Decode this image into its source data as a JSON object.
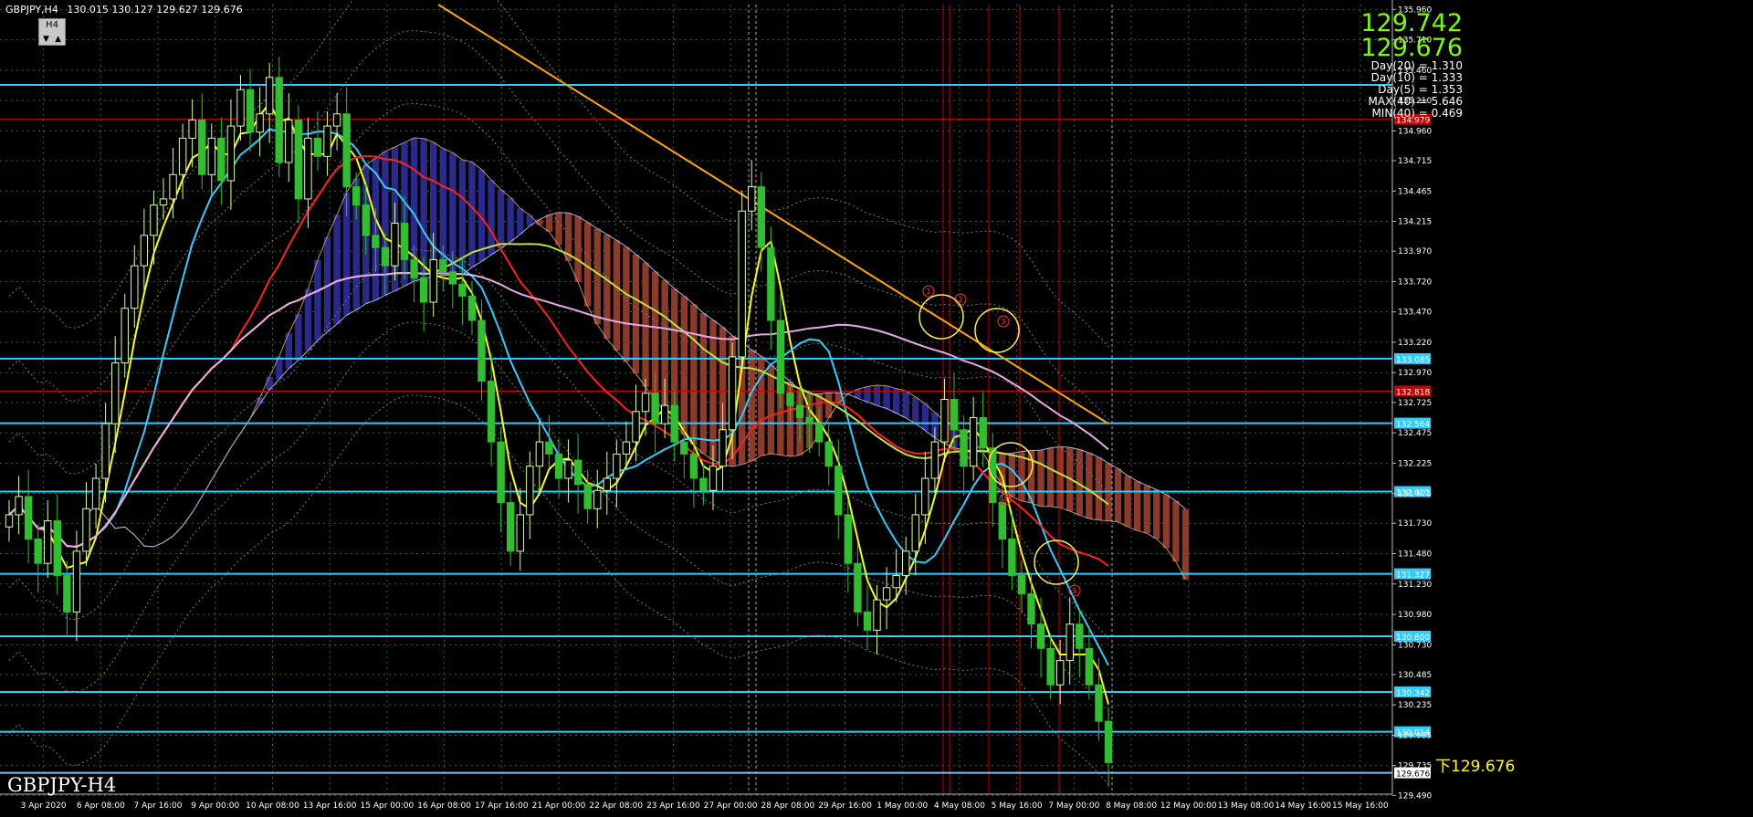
{
  "header": {
    "symbol": "GBPJPY,H4",
    "ohlc": "130.015 130.127 129.627 129.676",
    "timeframe": "H4"
  },
  "info": {
    "price_high": "129.742",
    "price_current": "129.676",
    "stats": [
      "Day(20) = 1.310",
      "Day(10) = 1.333",
      "Day(5) = 1.353",
      "MAX(40) = 5.646",
      "MIN(40) = 0.469"
    ]
  },
  "watermark": "GBPJPY-H4",
  "low_label": "下129.676",
  "colors": {
    "background": "#000000",
    "grid": "#2e6b2e",
    "bull_candle": "#d8ff9a",
    "bear_candle": "#2fbf2f",
    "cyan_level": "#33ccff",
    "red_level": "#cc0000",
    "trendline": "#ffa500",
    "ma_yellow": "#ffff00",
    "ma_cyan": "#33ccff",
    "ma_red": "#ff2020",
    "ma_lime": "#bfe23c",
    "ma_violet": "#e6a8e6",
    "price_label_cyan": "#33ccff",
    "price_label_red": "#cc0000"
  },
  "chart_data": {
    "type": "candlestick",
    "y_range": [
      129.5,
      136.0
    ],
    "y_ticks": [
      "135.960",
      "135.710",
      "135.460",
      "135.210",
      "134.960",
      "134.715",
      "134.465",
      "134.215",
      "133.970",
      "133.720",
      "133.470",
      "133.220",
      "132.970",
      "132.725",
      "132.475",
      "132.225",
      "131.975",
      "131.730",
      "131.480",
      "131.230",
      "130.980",
      "130.730",
      "130.485",
      "130.235",
      "129.985",
      "129.735",
      "129.490"
    ],
    "x_labels": [
      "3 Apr 2020",
      "6 Apr 08:00",
      "7 Apr 16:00",
      "9 Apr 00:00",
      "10 Apr 08:00",
      "13 Apr 16:00",
      "15 Apr 00:00",
      "16 Apr 08:00",
      "17 Apr 16:00",
      "21 Apr 00:00",
      "22 Apr 08:00",
      "23 Apr 16:00",
      "27 Apr 00:00",
      "28 Apr 08:00",
      "29 Apr 16:00",
      "1 May 00:00",
      "4 May 08:00",
      "5 May 16:00",
      "7 May 00:00",
      "8 May 08:00",
      "12 May 00:00",
      "13 May 08:00",
      "14 May 16:00",
      "15 May 16:00"
    ],
    "price_levels": [
      {
        "value": 135.339,
        "label": "",
        "color": "cyan"
      },
      {
        "value": 135.056,
        "label": "134.979",
        "color": "red"
      },
      {
        "value": 133.085,
        "label": "133.085",
        "color": "cyan"
      },
      {
        "value": 132.818,
        "label": "132.818",
        "color": "red"
      },
      {
        "value": 132.554,
        "label": "132.564",
        "color": "cyan"
      },
      {
        "value": 131.991,
        "label": "132.011",
        "color": "cyan"
      },
      {
        "value": 131.314,
        "label": "131.327",
        "color": "cyan"
      },
      {
        "value": 130.8,
        "label": "130.800",
        "color": "cyan"
      },
      {
        "value": 130.342,
        "label": "130.342",
        "color": "cyan"
      },
      {
        "value": 130.014,
        "label": "130.014",
        "color": "cyan"
      },
      {
        "value": 129.676,
        "label": "129.676",
        "color": "current"
      }
    ],
    "close_series": [
      131.8,
      131.95,
      131.6,
      131.4,
      131.75,
      131.3,
      131.0,
      131.5,
      131.85,
      132.1,
      132.55,
      133.05,
      133.5,
      133.85,
      134.1,
      134.35,
      134.4,
      134.6,
      134.9,
      135.05,
      134.6,
      134.9,
      134.55,
      135.0,
      135.3,
      134.95,
      135.1,
      135.4,
      134.7,
      135.05,
      134.4,
      134.9,
      134.75,
      135.0,
      135.1,
      134.5,
      134.35,
      134.1,
      134.0,
      133.85,
      134.2,
      133.9,
      133.75,
      133.55,
      133.9,
      133.8,
      133.7,
      133.6,
      133.4,
      132.9,
      132.4,
      131.9,
      131.5,
      131.8,
      132.2,
      132.4,
      132.3,
      132.1,
      132.25,
      132.05,
      131.85,
      132.0,
      132.1,
      132.3,
      132.4,
      132.65,
      132.8,
      132.55,
      132.7,
      132.4,
      132.3,
      132.1,
      132.0,
      132.2,
      132.5,
      133.1,
      134.3,
      134.5,
      134.0,
      133.4,
      132.8,
      132.7,
      132.6,
      132.55,
      132.4,
      132.2,
      131.8,
      131.4,
      131.0,
      130.85,
      131.1,
      131.2,
      131.3,
      131.5,
      131.8,
      132.1,
      132.4,
      132.75,
      132.5,
      132.2,
      132.6,
      132.35,
      131.9,
      131.6,
      131.3,
      131.15,
      130.9,
      130.7,
      130.4,
      130.6,
      130.9,
      130.7,
      130.4,
      130.1,
      129.76
    ],
    "annotations": [
      "1",
      "2",
      "3",
      "4",
      "5"
    ]
  }
}
